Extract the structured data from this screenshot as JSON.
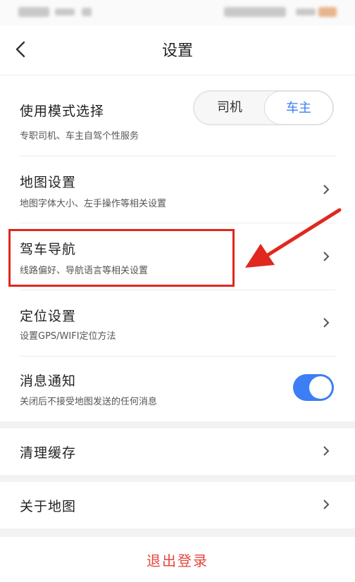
{
  "header": {
    "title": "设置"
  },
  "mode": {
    "title": "使用模式选择",
    "subtitle": "专职司机、车主自驾个性服务",
    "options": [
      "司机",
      "车主"
    ],
    "selected": "车主"
  },
  "settings": {
    "map": {
      "title": "地图设置",
      "subtitle": "地图字体大小、左手操作等相关设置"
    },
    "nav": {
      "title": "驾车导航",
      "subtitle": "线路偏好、导航语言等相关设置"
    },
    "location": {
      "title": "定位设置",
      "subtitle": "设置GPS/WIFI定位方法"
    },
    "notify": {
      "title": "消息通知",
      "subtitle": "关闭后不接受地图发送的任何消息",
      "enabled": true
    }
  },
  "cache": {
    "title": "清理缓存"
  },
  "about": {
    "title": "关于地图"
  },
  "logout": {
    "label": "退出登录"
  },
  "colors": {
    "accent": "#3d7ef5",
    "annotation": "#e0281e",
    "logout": "#e8453c"
  }
}
